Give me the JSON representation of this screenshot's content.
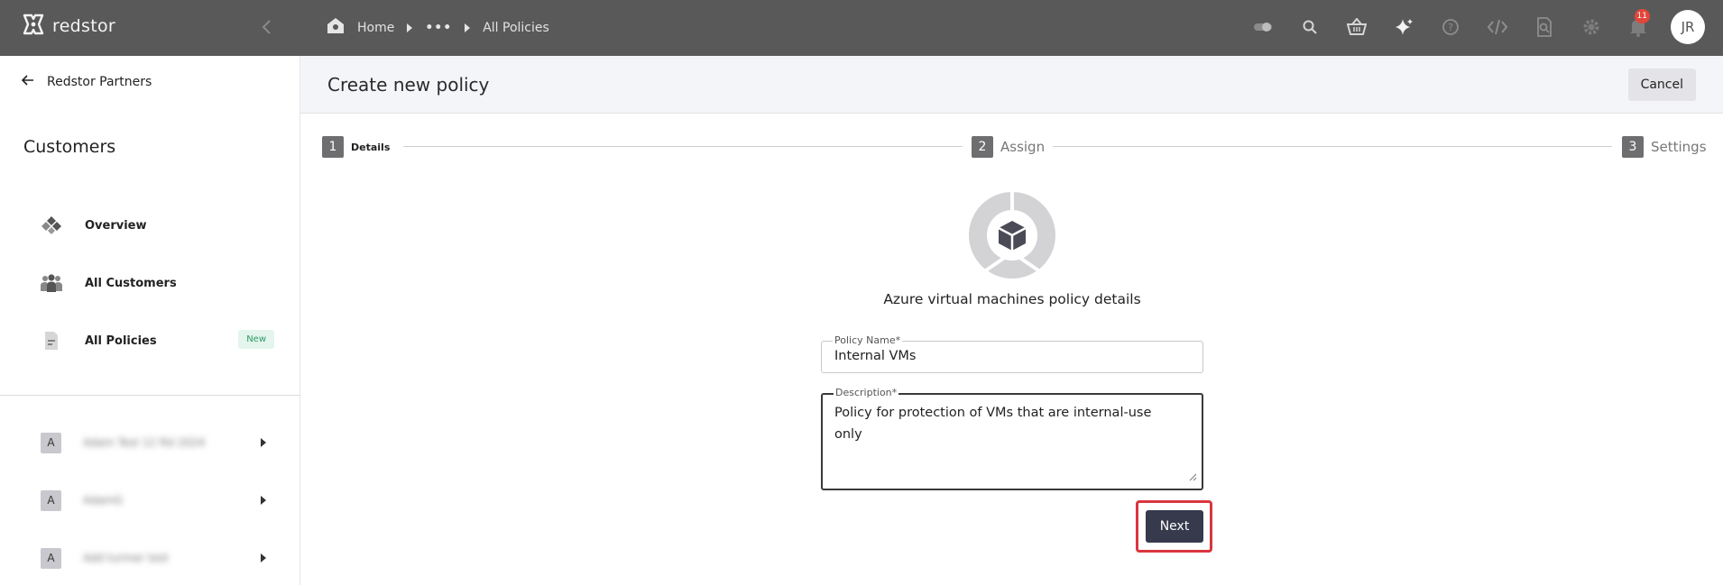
{
  "topbar": {
    "brand": "redstor",
    "breadcrumb": {
      "home": "Home",
      "ellipsis": "•••",
      "current": "All Policies"
    },
    "icons": [
      "toggle-icon",
      "search-icon",
      "basket-icon",
      "sparkle-icon",
      "help-icon",
      "code-icon",
      "document-search-icon",
      "gear-icon",
      "bell-icon"
    ],
    "notification_count": "11",
    "user_initials": "JR"
  },
  "sidebar": {
    "back_label": "Redstor Partners",
    "section_title": "Customers",
    "items": [
      {
        "label": "Overview",
        "icon": "overview-icon"
      },
      {
        "label": "All Customers",
        "icon": "customers-icon"
      },
      {
        "label": "All Policies",
        "icon": "policy-document-icon",
        "badge": "New"
      }
    ],
    "customers": [
      {
        "letter": "A",
        "name": "Adam Test 12 Rd 2024"
      },
      {
        "letter": "A",
        "name": "AdamG"
      },
      {
        "letter": "A",
        "name": "Add turmer test"
      }
    ]
  },
  "header": {
    "title": "Create new policy",
    "cancel_label": "Cancel"
  },
  "stepper": [
    {
      "number": "1",
      "label": "Details",
      "active": true
    },
    {
      "number": "2",
      "label": "Assign",
      "active": false
    },
    {
      "number": "3",
      "label": "Settings",
      "active": false
    }
  ],
  "form": {
    "title": "Azure virtual machines policy details",
    "policy_name_label": "Policy Name*",
    "policy_name_value": "Internal VMs",
    "description_label": "Description*",
    "description_value": "Policy for protection of VMs that are internal-use only",
    "next_label": "Next"
  },
  "colors": {
    "topbar": "#595959",
    "primary_button": "#373a4d",
    "highlight": "#d9363e",
    "new_badge": "#2f9a66"
  }
}
